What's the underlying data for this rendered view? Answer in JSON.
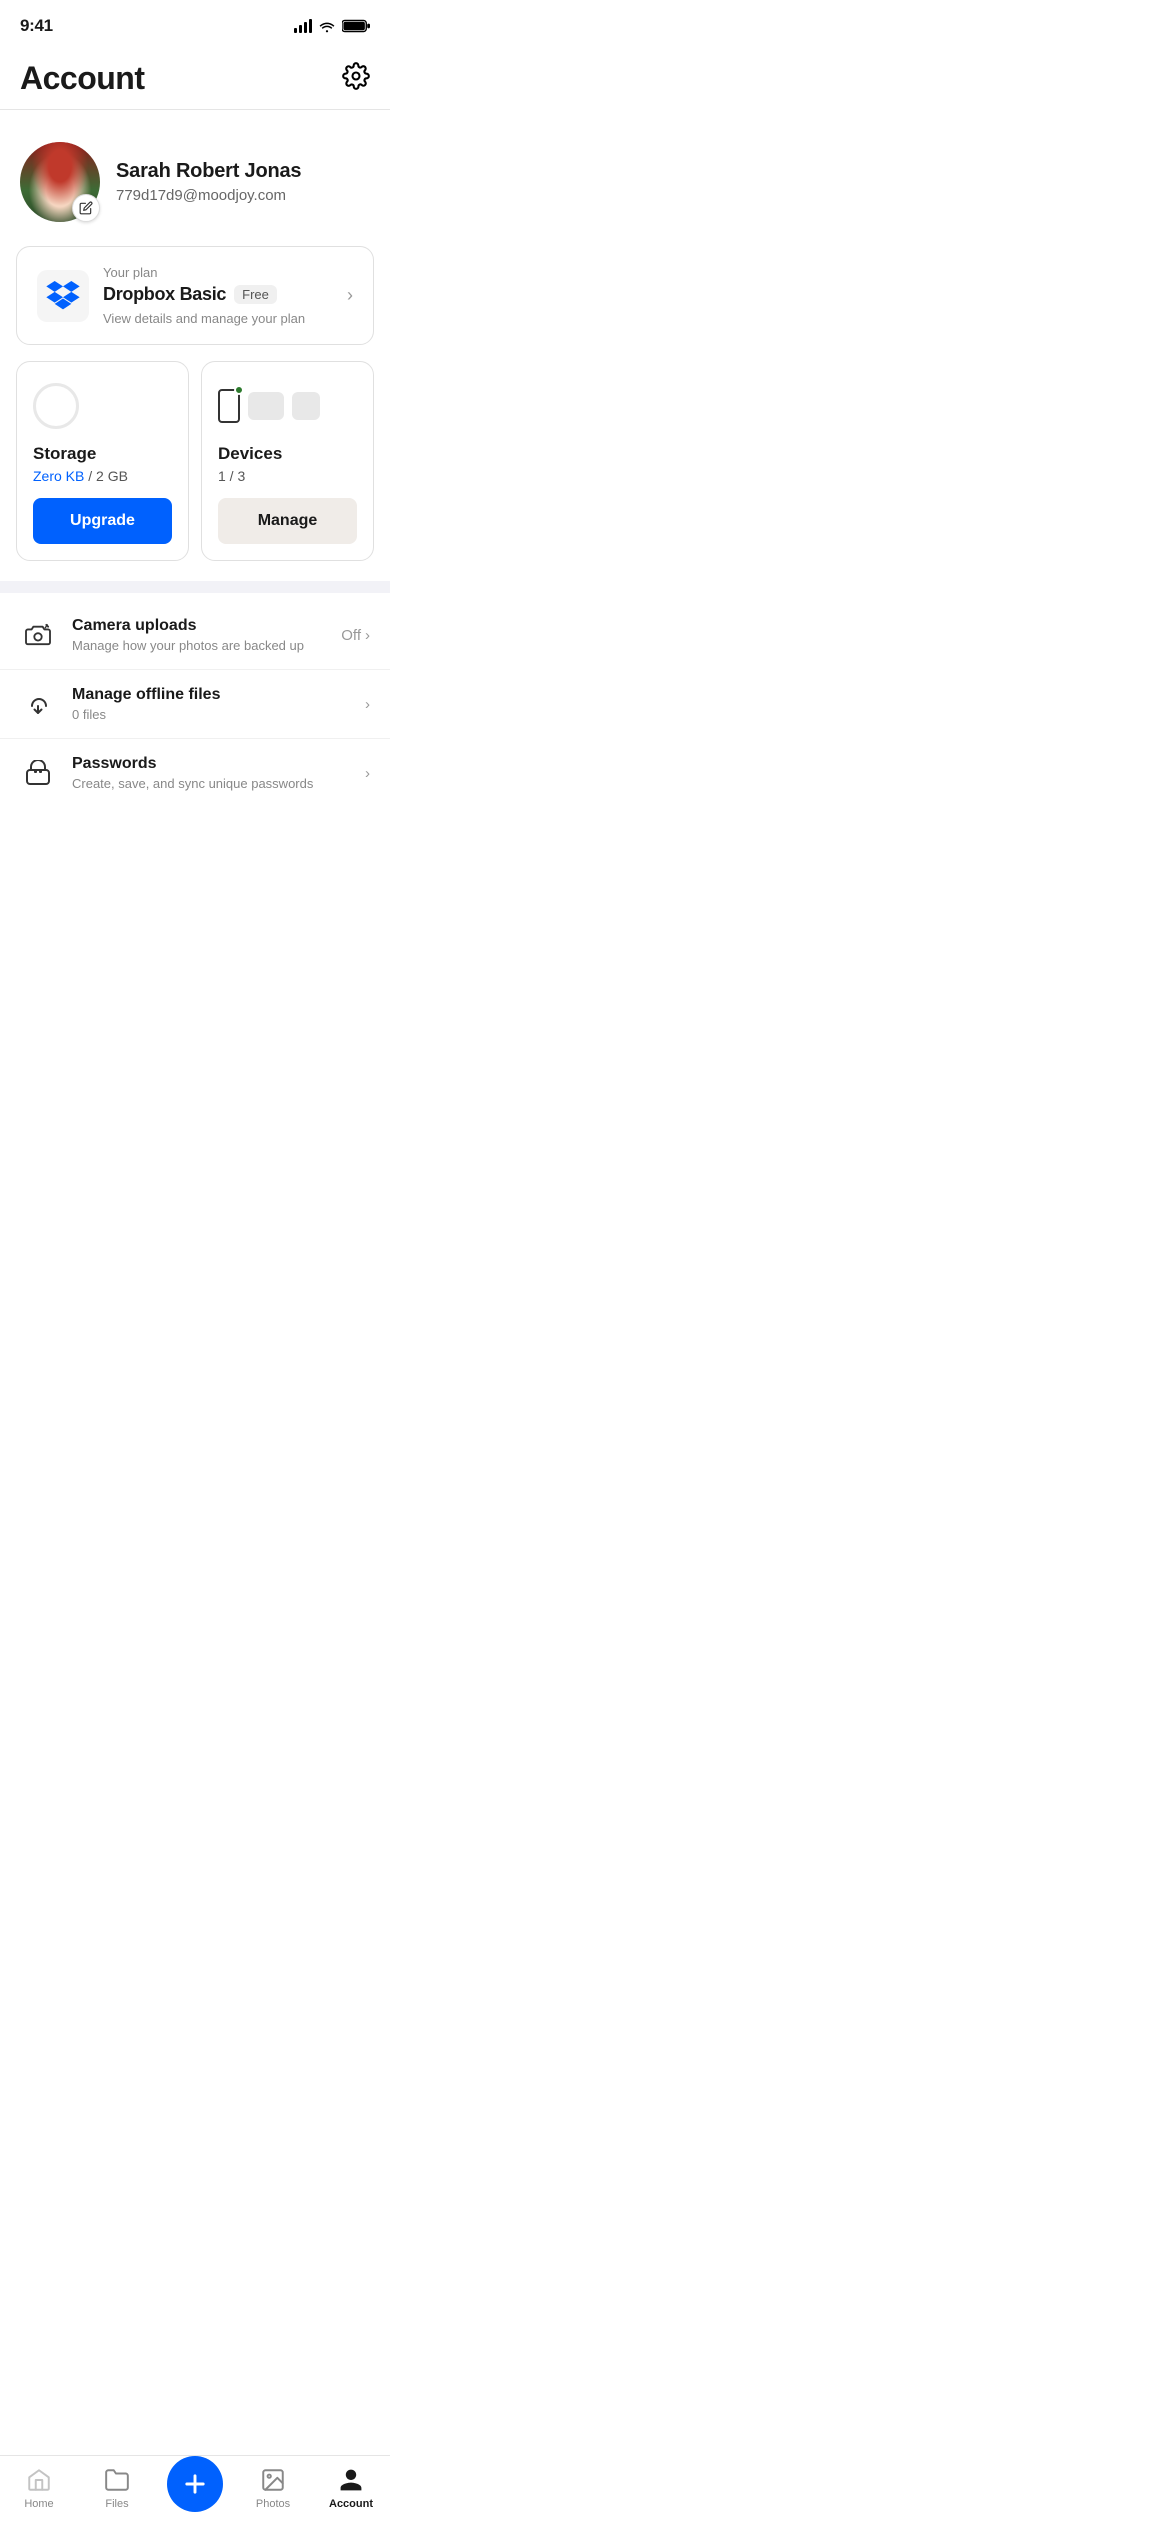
{
  "statusBar": {
    "time": "9:41"
  },
  "header": {
    "title": "Account",
    "settingsLabel": "settings"
  },
  "profile": {
    "name": "Sarah Robert Jonas",
    "email": "779d17d9@moodjoy.com",
    "editLabel": "edit"
  },
  "planCard": {
    "yourPlanLabel": "Your plan",
    "planName": "Dropbox Basic",
    "freeBadge": "Free",
    "description": "View details and manage your plan"
  },
  "storageCard": {
    "title": "Storage",
    "used": "Zero KB",
    "separator": "/",
    "total": "2 GB",
    "upgradeLabel": "Upgrade"
  },
  "devicesCard": {
    "title": "Devices",
    "count": "1 / 3",
    "manageLabel": "Manage"
  },
  "menuItems": [
    {
      "id": "camera-uploads",
      "title": "Camera uploads",
      "description": "Manage how your photos are backed up",
      "status": "Off",
      "hasChevron": true
    },
    {
      "id": "offline-files",
      "title": "Manage offline files",
      "description": "0 files",
      "status": "",
      "hasChevron": true
    },
    {
      "id": "passwords",
      "title": "Passwords",
      "description": "Create, save, and sync unique passwords",
      "status": "",
      "hasChevron": true
    }
  ],
  "bottomNav": {
    "items": [
      {
        "id": "home",
        "label": "Home",
        "active": false
      },
      {
        "id": "files",
        "label": "Files",
        "active": false
      },
      {
        "id": "add",
        "label": "",
        "active": false
      },
      {
        "id": "photos",
        "label": "Photos",
        "active": false
      },
      {
        "id": "account",
        "label": "Account",
        "active": true
      }
    ],
    "addLabel": "+"
  }
}
